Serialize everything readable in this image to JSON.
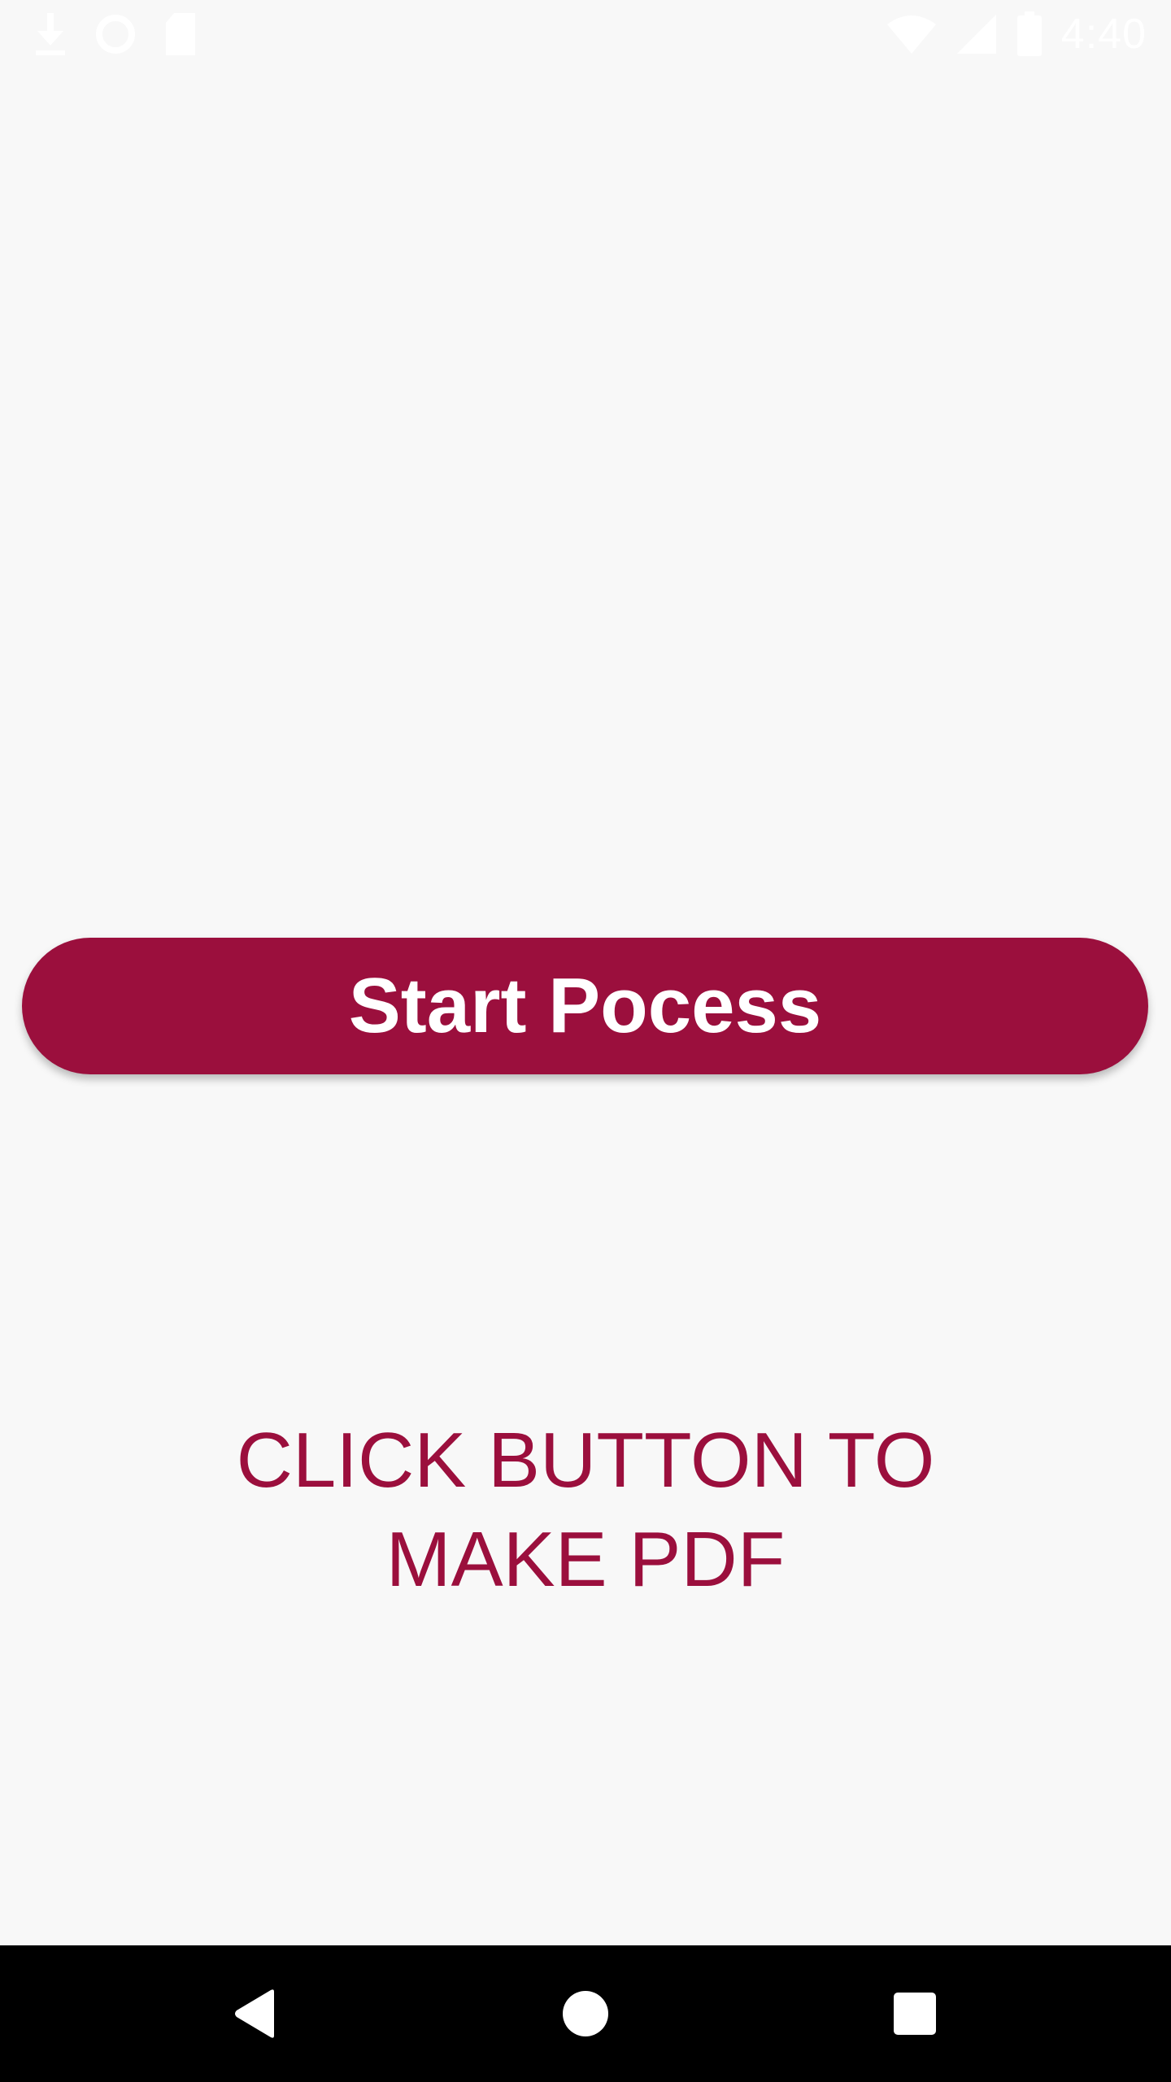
{
  "status_bar": {
    "time": "4:40",
    "icons_left": [
      "download-icon",
      "sync-icon",
      "sd-card-icon"
    ],
    "icons_right": [
      "wifi-icon",
      "signal-icon",
      "battery-icon"
    ]
  },
  "main": {
    "button_label": "Start Pocess",
    "instruction_line1": "CLICK BUTTON TO",
    "instruction_line2": "MAKE PDF"
  },
  "nav_bar": {
    "buttons": [
      "back-icon",
      "home-icon",
      "recents-icon"
    ]
  },
  "colors": {
    "accent": "#9b0f3d",
    "background": "#f8f8f8",
    "nav_background": "#000000"
  }
}
